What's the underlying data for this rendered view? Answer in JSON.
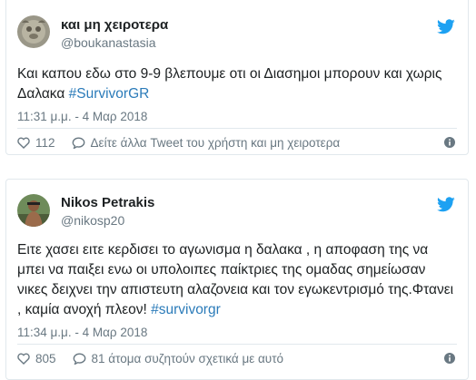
{
  "tweets": [
    {
      "display_name": "και μη χειροτερα",
      "handle": "@boukanastasia",
      "text_plain": "Και καπου εδω στο 9-9 βλεπουμε οτι οι Διασημοι μπορουν και χωρις Δαλακα  ",
      "hashtag": "#SurvivorGR",
      "time": "11:31 μ.μ. - 4 Μαρ 2018",
      "likes": "112",
      "reply_action": "Δείτε άλλα Tweet του χρήστη και μη χειροτερα"
    },
    {
      "display_name": "Nikos Petrakis",
      "handle": "@nikosp20",
      "text_plain": "Ειτε χασει ειτε κερδισει το αγωνισμα η δαλακα , η αποφαση της να μπει να παιξει ενω οι υπολοιπες παίκτριες της ομαδας σημείωσαν νικες δειχνει την απιστευτη αλαζονεια και τον εγωκεντρισμό της.Φτανει , καμία ανοχή πλεον! ",
      "hashtag": "#survivorgr",
      "time": "11:34 μ.μ. - 4 Μαρ 2018",
      "likes": "805",
      "reply_action": "81 άτομα συζητούν σχετικά με αυτό"
    }
  ],
  "icons": {
    "bird": "twitter-bird-icon",
    "heart": "heart-icon",
    "reply": "reply-bubble-icon",
    "info": "info-icon"
  },
  "colors": {
    "accent": "#1da1f2",
    "link": "#2b7bb9",
    "muted": "#697882",
    "border": "#e1e8ed"
  }
}
